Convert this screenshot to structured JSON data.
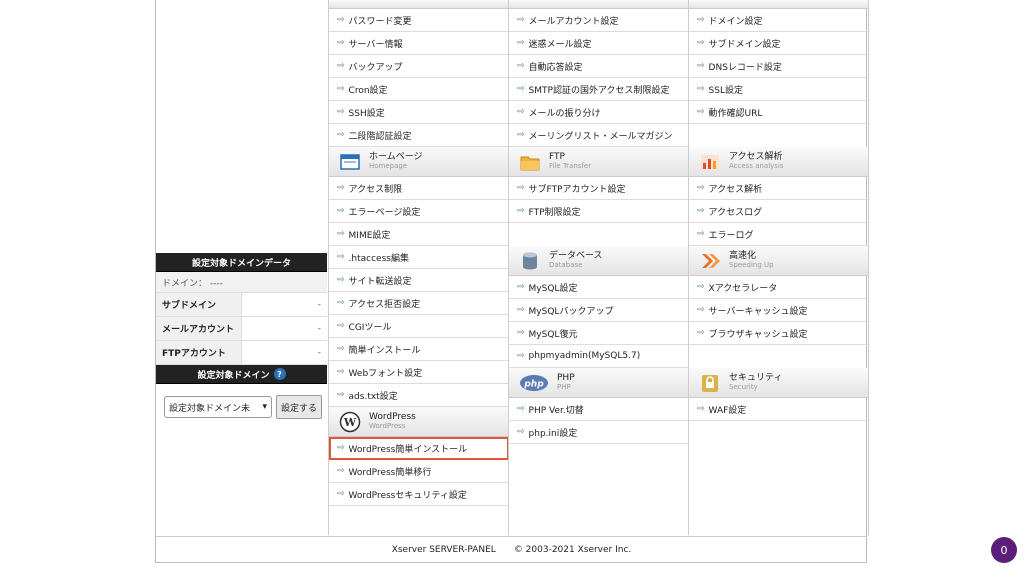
{
  "sidebar": {
    "domain_data_title": "設定対象ドメインデータ",
    "domain_line": "ドメイン： ----",
    "rows": [
      {
        "label": "サブドメイン",
        "value": "-"
      },
      {
        "label": "メールアカウント",
        "value": "-"
      },
      {
        "label": "FTPアカウント",
        "value": "-"
      }
    ],
    "target_title": "設定対象ドメイン",
    "help": "?",
    "select_value": "設定対象ドメイン未",
    "submit_label": "設定する"
  },
  "col1": {
    "account_items": [
      "パスワード変更",
      "サーバー情報",
      "バックアップ",
      "Cron設定",
      "SSH設定",
      "二段階認証設定"
    ],
    "homepage": {
      "title": "ホームページ",
      "sub": "Homepage",
      "items": [
        "アクセス制限",
        "エラーページ設定",
        "MIME設定",
        ".htaccess編集",
        "サイト転送設定",
        "アクセス拒否設定",
        "CGIツール",
        "簡単インストール",
        "Webフォント設定",
        "ads.txt設定"
      ]
    },
    "wordpress": {
      "title": "WordPress",
      "sub": "WordPress",
      "items": [
        "WordPress簡単インストール",
        "WordPress簡単移行",
        "WordPressセキュリティ設定"
      ]
    }
  },
  "col2": {
    "mail_items": [
      "メールアカウント設定",
      "迷惑メール設定",
      "自動応答設定",
      "SMTP認証の国外アクセス制限設定",
      "メールの振り分け",
      "メーリングリスト・メールマガジン"
    ],
    "ftp": {
      "title": "FTP",
      "sub": "File Transfer",
      "items": [
        "サブFTPアカウント設定",
        "FTP制限設定"
      ]
    },
    "database": {
      "title": "データベース",
      "sub": "Database",
      "items": [
        "MySQL設定",
        "MySQLバックアップ",
        "MySQL復元",
        "phpmyadmin(MySQL5.7)"
      ]
    },
    "php": {
      "title": "PHP",
      "sub": "PHP",
      "items": [
        "PHP Ver.切替",
        "php.ini設定"
      ]
    }
  },
  "col3": {
    "domain_items": [
      "ドメイン設定",
      "サブドメイン設定",
      "DNSレコード設定",
      "SSL設定",
      "動作確認URL"
    ],
    "access": {
      "title": "アクセス解析",
      "sub": "Access analysis",
      "items": [
        "アクセス解析",
        "アクセスログ",
        "エラーログ"
      ]
    },
    "speed": {
      "title": "高速化",
      "sub": "Speeding Up",
      "items": [
        "Xアクセラレータ",
        "サーバーキャッシュ設定",
        "ブラウザキャッシュ設定"
      ]
    },
    "security": {
      "title": "セキュリティ",
      "sub": "Security",
      "items": [
        "WAF設定"
      ]
    }
  },
  "footer": {
    "left": "Xserver SERVER-PANEL",
    "right": "© 2003-2021 Xserver Inc."
  },
  "badge": "0"
}
